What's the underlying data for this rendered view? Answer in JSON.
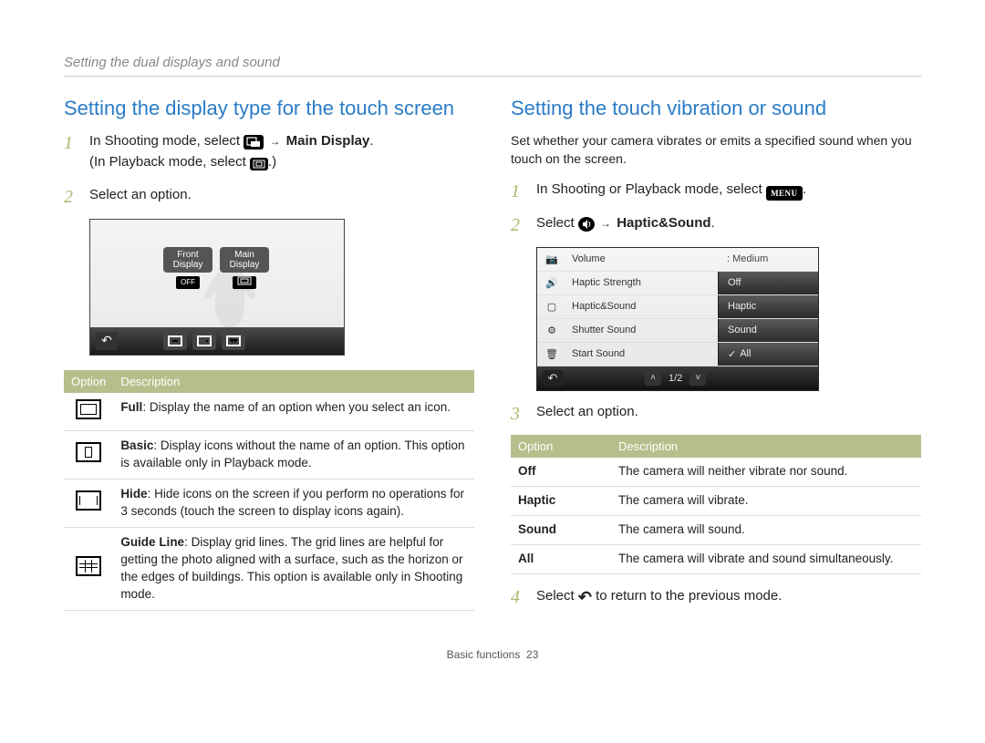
{
  "breadcrumb": "Setting the dual displays and sound",
  "footer": {
    "section": "Basic functions",
    "page": "23"
  },
  "left": {
    "title": "Setting the display type for the touch screen",
    "step1_a": "In Shooting mode, select ",
    "step1_b": " Main Display",
    "step1_c": ".",
    "step1_d": "In Playback mode, select ",
    "step1_e": ".)",
    "step2": "Select an option.",
    "figure": {
      "front_label_l1": "Front",
      "front_label_l2": "Display",
      "front_badge": "OFF",
      "main_label_l1": "Main",
      "main_label_l2": "Display"
    },
    "table": {
      "h1": "Option",
      "h2": "Description",
      "rows": [
        {
          "title": "Full",
          "desc": ": Display the name of an option when you select an icon."
        },
        {
          "title": "Basic",
          "desc": ": Display icons without the name of an option. This option is available only in Playback mode."
        },
        {
          "title": "Hide",
          "desc": ": Hide icons on the screen if you perform no operations for 3 seconds (touch the screen to display icons again)."
        },
        {
          "title": "Guide Line",
          "desc": ": Display grid lines. The grid lines are helpful for getting the photo aligned with a surface, such as the horizon or the edges of buildings. This option is available only in Shooting mode."
        }
      ]
    }
  },
  "right": {
    "title": "Setting the touch vibration or sound",
    "lead": "Set whether your camera vibrates or emits a specified sound when you touch on the screen.",
    "step1": "In Shooting or Playback mode, select ",
    "step1_b": ".",
    "step2_a": "Select ",
    "step2_b": " Haptic&Sound",
    "step2_c": ".",
    "step3": "Select an option.",
    "step4_a": "Select ",
    "step4_b": " to return to the previous mode.",
    "figure": {
      "rows": [
        {
          "label": "Volume",
          "value": ": Medium",
          "opt": ""
        },
        {
          "label": "Haptic Strength",
          "value": "",
          "opt": "Off"
        },
        {
          "label": "Haptic&Sound",
          "value": "",
          "opt": "Haptic"
        },
        {
          "label": "Shutter Sound",
          "value": "",
          "opt": "Sound"
        },
        {
          "label": "Start Sound",
          "value": "",
          "opt": "All",
          "check": true
        }
      ],
      "pager": "1/2"
    },
    "table": {
      "h1": "Option",
      "h2": "Description",
      "rows": [
        {
          "name": "Off",
          "desc": "The camera will neither vibrate nor sound."
        },
        {
          "name": "Haptic",
          "desc": "The camera will vibrate."
        },
        {
          "name": "Sound",
          "desc": "The camera will sound."
        },
        {
          "name": "All",
          "desc": "The camera will vibrate and sound simultaneously."
        }
      ]
    }
  },
  "icons": {
    "menu_label": "MENU",
    "arrow": "→",
    "back": "↶",
    "check": "✓",
    "up": "˄",
    "down": "˅",
    "sound": "🔊",
    "camera": "📷",
    "gear": "⚙",
    "trash": "🗑"
  }
}
